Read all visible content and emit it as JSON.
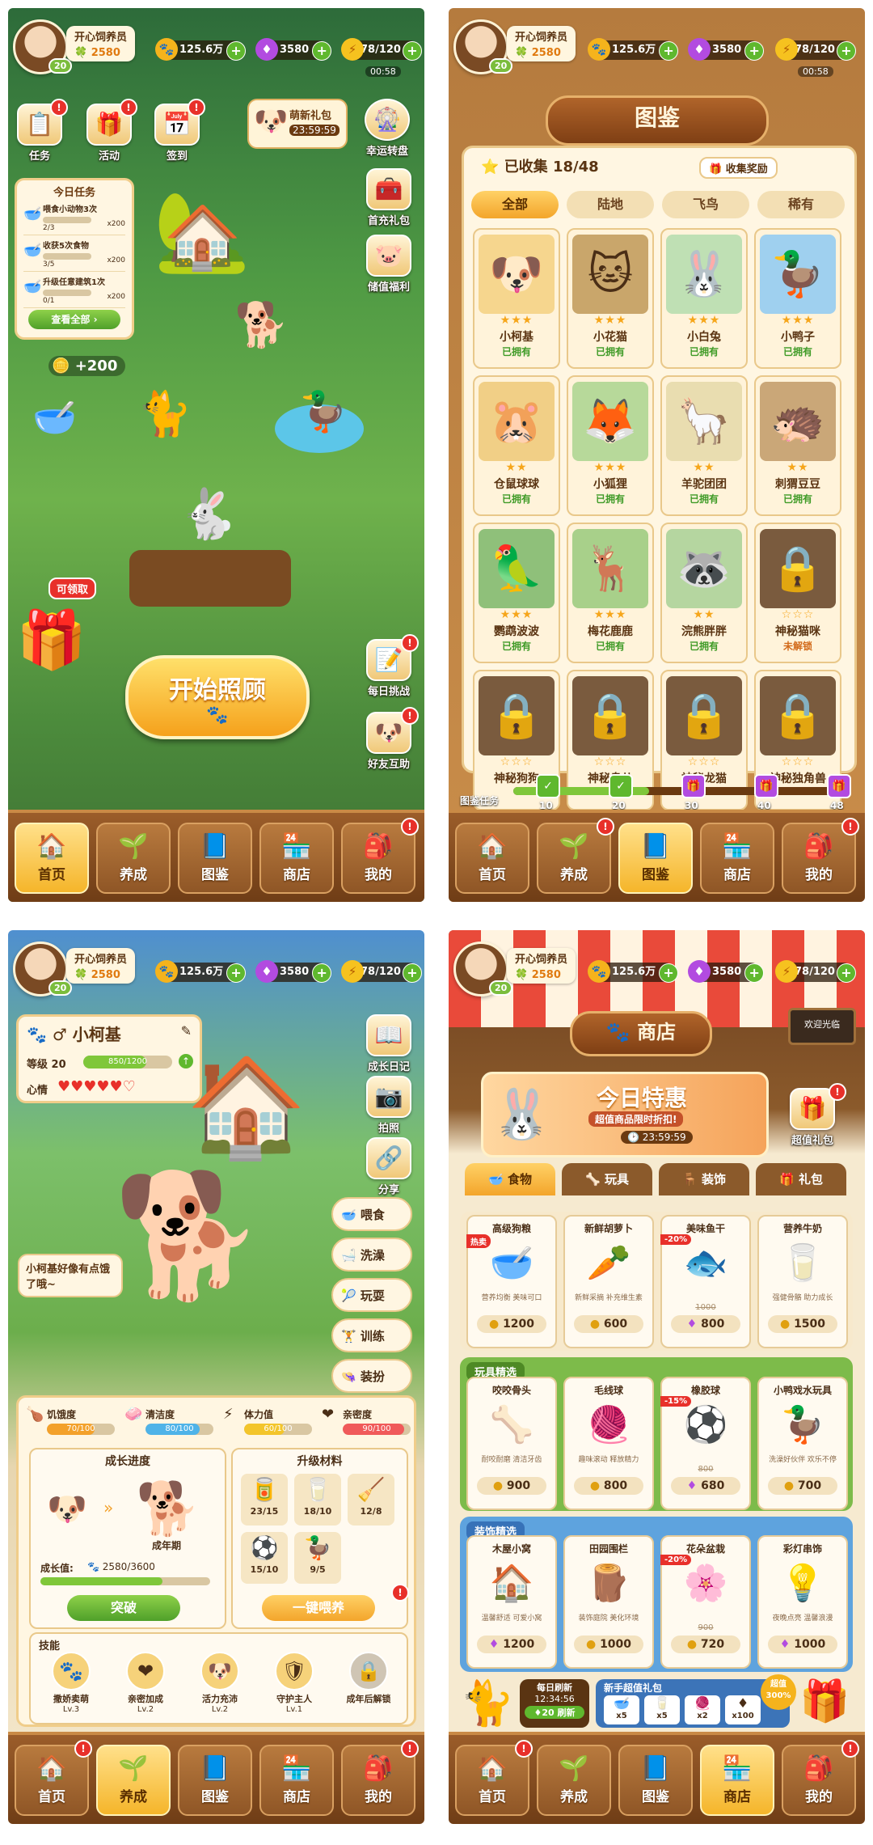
{
  "player": {
    "name": "开心饲养员",
    "clovers": "2580",
    "level": "20",
    "coins": "125.6万",
    "gems": "3580",
    "energy": "78/120",
    "energy_timer": "00:58"
  },
  "nav": [
    "首页",
    "养成",
    "图鉴",
    "商店",
    "我的"
  ],
  "home": {
    "top_icons": [
      "任务",
      "活动",
      "签到"
    ],
    "gift_title": "萌新礼包",
    "gift_timer": "23:59:59",
    "wheel": "幸运转盘",
    "right_icons": [
      "首充礼包",
      "储值福利",
      "每日挑战",
      "好友互助"
    ],
    "tasks_title": "今日任务",
    "tasks": [
      {
        "text": "喂食小动物3次",
        "progress": "2/3",
        "reward": "x200"
      },
      {
        "text": "收获5次食物",
        "progress": "3/5",
        "reward": "x200"
      },
      {
        "text": "升级任意建筑1次",
        "progress": "0/1",
        "reward": "x200"
      }
    ],
    "tasks_btn": "查看全部",
    "plus_coins": "+200",
    "claim": "可领取",
    "start_btn": "开始照顾"
  },
  "collection": {
    "title": "图鉴",
    "collected": "已收集 18/48",
    "reward_btn": "收集奖励",
    "tabs": [
      "全部",
      "陆地",
      "飞鸟",
      "稀有"
    ],
    "pets": [
      {
        "name": "小柯基",
        "status": "已拥有",
        "stars": "★★★",
        "icon": "🐶"
      },
      {
        "name": "小花猫",
        "status": "已拥有",
        "stars": "★★★",
        "icon": "🐱"
      },
      {
        "name": "小白兔",
        "status": "已拥有",
        "stars": "★★★",
        "icon": "🐰"
      },
      {
        "name": "小鸭子",
        "status": "已拥有",
        "stars": "★★★",
        "icon": "🦆"
      },
      {
        "name": "仓鼠球球",
        "status": "已拥有",
        "stars": "★★",
        "icon": "🐹"
      },
      {
        "name": "小狐狸",
        "status": "已拥有",
        "stars": "★★★",
        "icon": "🦊"
      },
      {
        "name": "羊驼团团",
        "status": "已拥有",
        "stars": "★★",
        "icon": "🦙"
      },
      {
        "name": "刺猬豆豆",
        "status": "已拥有",
        "stars": "★★",
        "icon": "🦔"
      },
      {
        "name": "鹦鹉波波",
        "status": "已拥有",
        "stars": "★★★",
        "icon": "🦜"
      },
      {
        "name": "梅花鹿鹿",
        "status": "已拥有",
        "stars": "★★★",
        "icon": "🦌"
      },
      {
        "name": "浣熊胖胖",
        "status": "已拥有",
        "stars": "★★",
        "icon": "🦝"
      },
      {
        "name": "神秘猫咪",
        "status": "未解锁",
        "stars": "☆☆☆",
        "icon": "🔒"
      },
      {
        "name": "神秘狗狗",
        "status": "",
        "stars": "☆☆☆",
        "icon": "🔒"
      },
      {
        "name": "神秘鸟儿",
        "status": "",
        "stars": "☆☆☆",
        "icon": "🔒"
      },
      {
        "name": "神秘龙猫",
        "status": "",
        "stars": "☆☆☆",
        "icon": "🔒"
      },
      {
        "name": "神秘独角兽",
        "status": "",
        "stars": "☆☆☆",
        "icon": "🔒"
      }
    ],
    "task_label": "图鉴任务",
    "milestones": [
      "10",
      "20",
      "30",
      "40",
      "48"
    ],
    "progress_fraction": 0.42
  },
  "pet": {
    "name": "小柯基",
    "level_label": "等级 20",
    "exp": "850/1200",
    "exp_fraction": 0.71,
    "mood_label": "心情",
    "hearts": "♥♥♥♥♥♡",
    "side_icons": [
      "成长日记",
      "拍照",
      "分享"
    ],
    "speech": "小柯基好像有点饿了哦~",
    "actions": [
      "喂食",
      "洗澡",
      "玩耍",
      "训练",
      "装扮"
    ],
    "stats": [
      {
        "label": "饥饿度",
        "value": "70/100",
        "fraction": 0.7,
        "color": "#f3a12b"
      },
      {
        "label": "清洁度",
        "value": "80/100",
        "fraction": 0.8,
        "color": "#4fb3e8"
      },
      {
        "label": "体力值",
        "value": "60/100",
        "fraction": 0.6,
        "color": "#f3c52b"
      },
      {
        "label": "亲密度",
        "value": "90/100",
        "fraction": 0.9,
        "color": "#f05a5a"
      }
    ],
    "growth_title": "成长进度",
    "stage": "成年期",
    "growth_label": "成长值:",
    "growth_value": "2580/3600",
    "growth_fraction": 0.72,
    "breakthrough": "突破",
    "materials_title": "升级材料",
    "materials": [
      {
        "icon": "🥫",
        "count": "23/15"
      },
      {
        "icon": "🥛",
        "count": "18/10"
      },
      {
        "icon": "🧹",
        "count": "12/8"
      },
      {
        "icon": "⚽",
        "count": "15/10"
      },
      {
        "icon": "🦆",
        "count": "9/5"
      }
    ],
    "feed_all": "一键喂养",
    "skills_title": "技能",
    "skills": [
      {
        "name": "撒娇卖萌",
        "lv": "Lv.3",
        "icon": "🐾"
      },
      {
        "name": "亲密加成",
        "lv": "Lv.2",
        "icon": "❤"
      },
      {
        "name": "活力充沛",
        "lv": "Lv.2",
        "icon": "🐶"
      },
      {
        "name": "守护主人",
        "lv": "Lv.1",
        "icon": "🛡"
      },
      {
        "name": "成年后解锁",
        "lv": "",
        "icon": "🔒"
      }
    ]
  },
  "shop": {
    "title": "商店",
    "welcome": "欢迎光临",
    "special_title": "今日特惠",
    "special_sub": "超值商品限时折扣!",
    "special_timer": "23:59:59",
    "super_gift": "超值礼包",
    "tabs": [
      "食物",
      "玩具",
      "装饰",
      "礼包"
    ],
    "food": [
      {
        "name": "高级狗粮",
        "desc": "营养均衡 美味可口",
        "price": "1200",
        "cur": "coin",
        "tag": "热卖",
        "old": "",
        "icon": "🥣"
      },
      {
        "name": "新鲜胡萝卜",
        "desc": "新鲜采摘 补充维生素",
        "price": "600",
        "cur": "coin",
        "tag": "",
        "old": "",
        "icon": "🥕"
      },
      {
        "name": "美味鱼干",
        "desc": "",
        "price": "800",
        "cur": "gem",
        "tag": "-20%",
        "old": "1000",
        "icon": "🐟"
      },
      {
        "name": "营养牛奶",
        "desc": "强健骨骼 助力成长",
        "price": "1500",
        "cur": "coin",
        "tag": "",
        "old": "",
        "icon": "🥛"
      }
    ],
    "toys_title": "玩具精选",
    "toys": [
      {
        "name": "咬咬骨头",
        "desc": "耐咬耐磨 清洁牙齿",
        "price": "900",
        "cur": "coin",
        "tag": "",
        "old": "",
        "icon": "🦴"
      },
      {
        "name": "毛线球",
        "desc": "趣味滚动 释放精力",
        "price": "800",
        "cur": "coin",
        "tag": "",
        "old": "",
        "icon": "🧶"
      },
      {
        "name": "橡胶球",
        "desc": "",
        "price": "680",
        "cur": "gem",
        "tag": "-15%",
        "old": "800",
        "icon": "⚽"
      },
      {
        "name": "小鸭戏水玩具",
        "desc": "洗澡好伙伴 欢乐不停",
        "price": "700",
        "cur": "coin",
        "tag": "",
        "old": "",
        "icon": "🦆"
      }
    ],
    "decor_title": "装饰精选",
    "decor": [
      {
        "name": "木屋小窝",
        "desc": "温馨舒适 可爱小窝",
        "price": "1200",
        "cur": "gem",
        "tag": "",
        "old": "",
        "icon": "🏠"
      },
      {
        "name": "田园围栏",
        "desc": "装饰庭院 美化环境",
        "price": "1000",
        "cur": "coin",
        "tag": "",
        "old": "",
        "icon": "🪵"
      },
      {
        "name": "花朵盆栽",
        "desc": "",
        "price": "720",
        "cur": "coin",
        "tag": "-20%",
        "old": "900",
        "icon": "🌸"
      },
      {
        "name": "彩灯串饰",
        "desc": "夜晚点亮 温馨浪漫",
        "price": "1000",
        "cur": "gem",
        "tag": "",
        "old": "",
        "icon": "💡"
      }
    ],
    "daily_refresh": "每日刷新",
    "refresh_timer": "12:34:56",
    "refresh_btn": "20 刷新",
    "newbie_pack": "新手超值礼包",
    "pack_items": [
      "x5",
      "x5",
      "x2",
      "x100"
    ],
    "value_badge": "超值300%"
  }
}
